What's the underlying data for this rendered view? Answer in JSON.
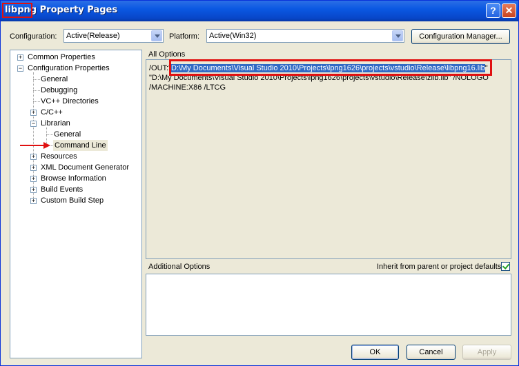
{
  "window": {
    "title_app": "libpng",
    "title_rest": " Property Pages",
    "help_glyph": "?",
    "close_glyph": "✕"
  },
  "toolbar": {
    "configuration_label": "Configuration:",
    "configuration_value": "Active(Release)",
    "platform_label": "Platform:",
    "platform_value": "Active(Win32)",
    "config_manager_label": "Configuration Manager..."
  },
  "tree": {
    "common_properties": "Common Properties",
    "configuration_properties": "Configuration Properties",
    "general": "General",
    "debugging": "Debugging",
    "vc_directories": "VC++ Directories",
    "c_cpp": "C/C++",
    "librarian": "Librarian",
    "librarian_general": "General",
    "command_line": "Command Line",
    "resources": "Resources",
    "xml_doc_gen": "XML Document Generator",
    "browse_info": "Browse Information",
    "build_events": "Build Events",
    "custom_build_step": "Custom Build Step",
    "expand_plus": "+",
    "expand_minus": "−"
  },
  "all_options": {
    "label": "All Options",
    "line1_prefix": "/OUT:\"",
    "line1_selected": "D:\\My Documents\\Visual Studio 2010\\Projects\\lpng1626\\projects\\vstudio\\Release\\libpng16.lib",
    "line1_suffix": "\"",
    "line2": "\"D:\\My Documents\\Visual Studio 2010\\Projects\\lpng1626\\projects\\vstudio\\Release\\zlib.lib\" /NOLOGO",
    "line3": "/MACHINE:X86 /LTCG"
  },
  "additional_options": {
    "label": "Additional Options",
    "inherit_label": "Inherit from parent or project defaults",
    "inherit_checked": true
  },
  "buttons": {
    "ok": "OK",
    "cancel": "Cancel",
    "apply": "Apply"
  },
  "colors": {
    "title_bar": "#0a58e2",
    "selection": "#316ac5",
    "highlight_annotation": "#e01010"
  }
}
